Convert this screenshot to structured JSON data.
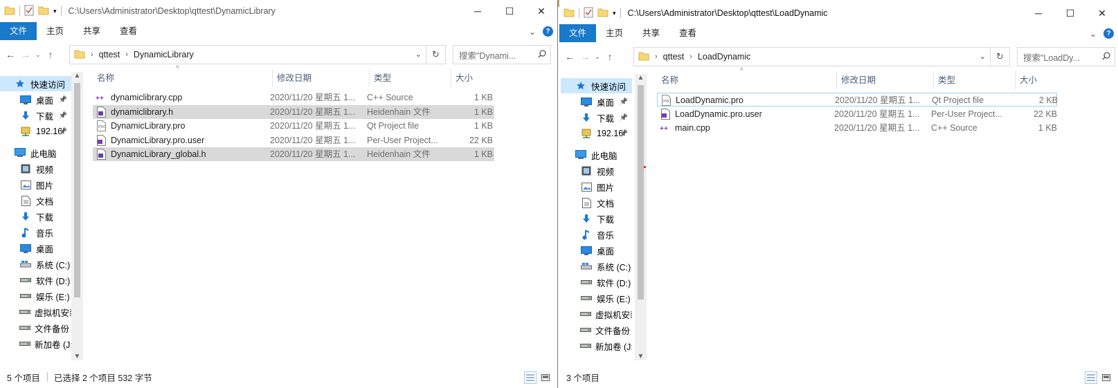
{
  "left": {
    "path": "C:\\Users\\Administrator\\Desktop\\qttest\\DynamicLibrary",
    "ribbon_tabs": [
      "文件",
      "主页",
      "共享",
      "查看"
    ],
    "breadcrumb": [
      "qttest",
      "DynamicLibrary"
    ],
    "search_placeholder": "搜索\"Dynami...",
    "columns": [
      "名称",
      "修改日期",
      "类型",
      "大小"
    ],
    "files": [
      {
        "name": "dynamiclibrary.cpp",
        "date": "2020/11/20 星期五 1...",
        "type": "C++ Source",
        "size": "1 KB",
        "icon": "cpp-icon",
        "selected": false
      },
      {
        "name": "dynamiclibrary.h",
        "date": "2020/11/20 星期五 1...",
        "type": "Heidenhain 文件",
        "size": "1 KB",
        "icon": "header-file-icon",
        "selected": true
      },
      {
        "name": "DynamicLibrary.pro",
        "date": "2020/11/20 星期五 1...",
        "type": "Qt Project file",
        "size": "1 KB",
        "icon": "pro-file-icon",
        "selected": false
      },
      {
        "name": "DynamicLibrary.pro.user",
        "date": "2020/11/20 星期五 1...",
        "type": "Per-User Project...",
        "size": "22 KB",
        "icon": "user-file-icon",
        "selected": false
      },
      {
        "name": "DynamicLibrary_global.h",
        "date": "2020/11/20 星期五 1...",
        "type": "Heidenhain 文件",
        "size": "1 KB",
        "icon": "header-file-icon",
        "selected": true
      }
    ],
    "status_count": "5 个项目",
    "status_selected": "已选择 2 个项目  532 字节"
  },
  "right": {
    "path": "C:\\Users\\Administrator\\Desktop\\qttest\\LoadDynamic",
    "ribbon_tabs": [
      "文件",
      "主页",
      "共享",
      "查看"
    ],
    "breadcrumb": [
      "qttest",
      "LoadDynamic"
    ],
    "search_placeholder": "搜索\"LoadDy...",
    "columns": [
      "名称",
      "修改日期",
      "类型",
      "大小"
    ],
    "files": [
      {
        "name": "LoadDynamic.pro",
        "date": "2020/11/20 星期五 1...",
        "type": "Qt Project file",
        "size": "2 KB",
        "icon": "pro-file-icon",
        "selected": false
      },
      {
        "name": "LoadDynamic.pro.user",
        "date": "2020/11/20 星期五 1...",
        "type": "Per-User Project...",
        "size": "22 KB",
        "icon": "user-file-icon",
        "selected": false
      },
      {
        "name": "main.cpp",
        "date": "2020/11/20 星期五 1...",
        "type": "C++ Source",
        "size": "1 KB",
        "icon": "cpp-icon",
        "selected": false
      }
    ],
    "status_count": "3 个项目"
  },
  "nav_items": [
    {
      "label": "快速访问",
      "icon": "star-icon",
      "group": true
    },
    {
      "label": "桌面",
      "icon": "desktop-icon",
      "pinned": true
    },
    {
      "label": "下载",
      "icon": "download-icon",
      "pinned": true
    },
    {
      "label": "192.16",
      "icon": "network-drive-icon",
      "pinned": true
    },
    {
      "label": "此电脑",
      "icon": "computer-icon",
      "group": true
    },
    {
      "label": "视频",
      "icon": "video-icon"
    },
    {
      "label": "图片",
      "icon": "pictures-icon"
    },
    {
      "label": "文档",
      "icon": "documents-icon"
    },
    {
      "label": "下载",
      "icon": "download-icon"
    },
    {
      "label": "音乐",
      "icon": "music-icon"
    },
    {
      "label": "桌面",
      "icon": "desktop-icon"
    },
    {
      "label": "系统 (C:)",
      "icon": "drive-c-icon"
    },
    {
      "label": "软件 (D:)",
      "icon": "drive-icon"
    },
    {
      "label": "娱乐 (E:)",
      "icon": "drive-icon"
    },
    {
      "label": "虚拟机安装",
      "icon": "drive-icon"
    },
    {
      "label": "文件备份 (",
      "icon": "drive-icon"
    },
    {
      "label": "新加卷 (J:)",
      "icon": "drive-icon"
    }
  ],
  "colors": {
    "accent": "#1979ca",
    "selection": "#d9d9d9",
    "nav_selection": "#cce8ff",
    "header_text": "#4c607a"
  }
}
